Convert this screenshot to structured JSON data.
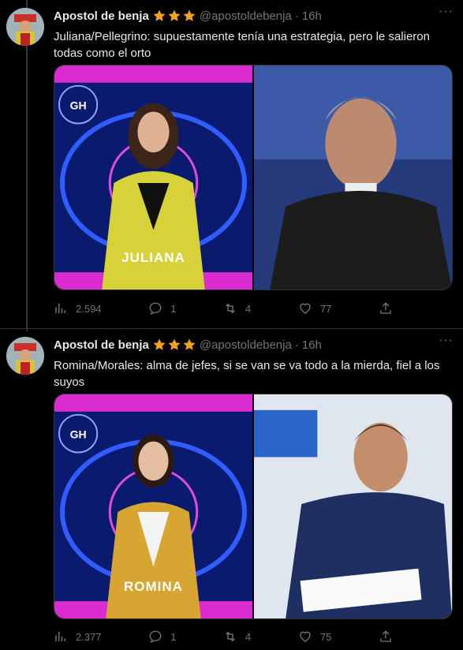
{
  "tweets": [
    {
      "author": "Apostol de benja",
      "handle": "@apostoldebenja",
      "time": "16h",
      "text": "Juliana/Pellegrino: supuestamente tenía una estrategia, pero le salieron todas como el orto",
      "media": {
        "left_caption": "JULIANA",
        "left_logo": "GH"
      },
      "stats": {
        "views": "2.594",
        "replies": "1",
        "retweets": "4",
        "likes": "77"
      }
    },
    {
      "author": "Apostol de benja",
      "handle": "@apostoldebenja",
      "time": "16h",
      "text": "Romina/Morales: alma de jefes, si se van se va todo a la mierda, fiel a los suyos",
      "media": {
        "left_caption": "ROMINA",
        "left_logo": "GH"
      },
      "stats": {
        "views": "2.377",
        "replies": "1",
        "retweets": "4",
        "likes": "75"
      }
    }
  ],
  "colors": {
    "background": "#000000",
    "text": "#e7e9ea",
    "muted": "#71767b",
    "star": "#f4a21e",
    "border": "#2f3336"
  },
  "icons": [
    "views-icon",
    "reply-icon",
    "retweet-icon",
    "like-icon",
    "share-icon",
    "star-icon",
    "more-icon"
  ]
}
